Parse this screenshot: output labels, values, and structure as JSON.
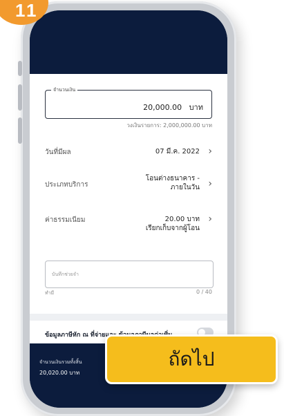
{
  "step_number": "11",
  "form": {
    "amount_label": "จำนวนเงิน",
    "amount_value": "20,000.00",
    "amount_unit": "บาท",
    "amount_hint": "วงเงินรายการ: 2,000,000.00 บาท",
    "rows": [
      {
        "label": "วันที่มีผล",
        "value": "07 มี.ค. 2022"
      },
      {
        "label": "ประเภทบริการ",
        "value_line1": "โอนต่างธนาคาร -",
        "value_line2": "ภายในวัน"
      },
      {
        "label": "ค่าธรรมเนียม",
        "value_line1": "20.00 บาท",
        "value_line2": "เรียกเก็บจากผู้โอน"
      }
    ],
    "memo_placeholder": "บันทึกช่วยจำ",
    "memo_optional": "ทำมี",
    "memo_counter": "0 / 40",
    "extra_info_label": "ข้อมูลภาษีหัก ณ ที่จ่ายและ ข้อมูลภาษีมูลค่าเพิ่ม",
    "extra_info_toggle_on": false
  },
  "footer": {
    "total_label": "จำนวนเงินรวมทั้งสิ้น",
    "total_value": "20,020.00 บาท"
  },
  "next_button_label": "ถัดไป",
  "colors": {
    "dark_navy": "#0c1c3d",
    "accent_yellow": "#f5bd1c",
    "badge_orange": "#f29a2e"
  }
}
